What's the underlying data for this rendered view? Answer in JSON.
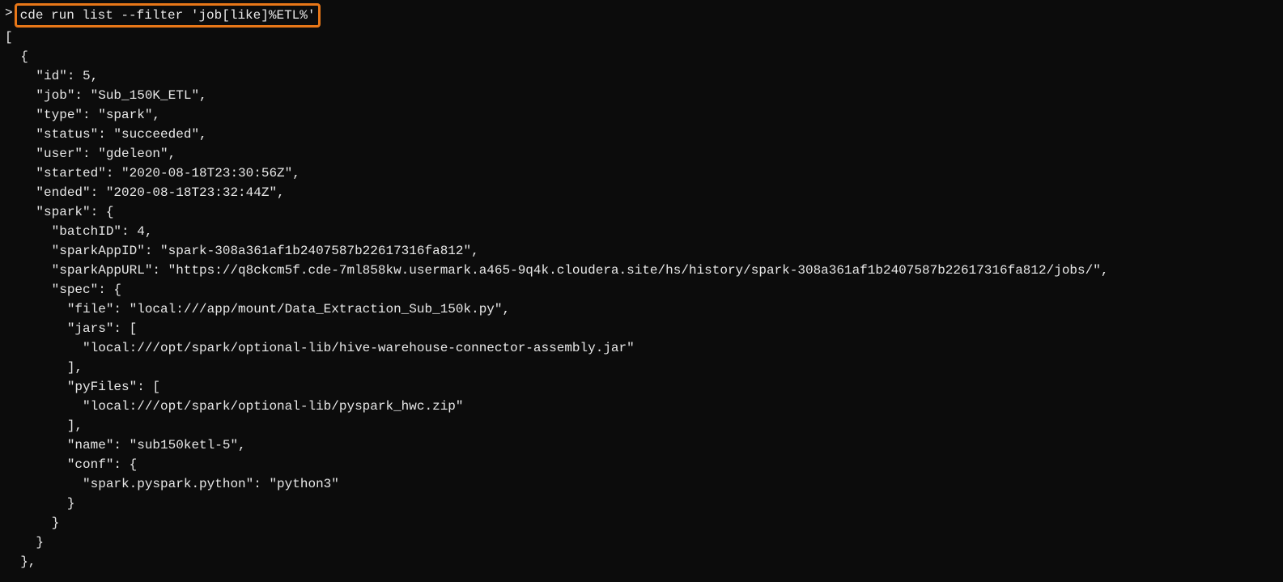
{
  "prompt": ">",
  "command": "cde run list --filter 'job[like]%ETL%'",
  "output_lines": [
    "[",
    "  {",
    "    \"id\": 5,",
    "    \"job\": \"Sub_150K_ETL\",",
    "    \"type\": \"spark\",",
    "    \"status\": \"succeeded\",",
    "    \"user\": \"gdeleon\",",
    "    \"started\": \"2020-08-18T23:30:56Z\",",
    "    \"ended\": \"2020-08-18T23:32:44Z\",",
    "    \"spark\": {",
    "      \"batchID\": 4,",
    "      \"sparkAppID\": \"spark-308a361af1b2407587b22617316fa812\",",
    "      \"sparkAppURL\": \"https://q8ckcm5f.cde-7ml858kw.usermark.a465-9q4k.cloudera.site/hs/history/spark-308a361af1b2407587b22617316fa812/jobs/\",",
    "      \"spec\": {",
    "        \"file\": \"local:///app/mount/Data_Extraction_Sub_150k.py\",",
    "        \"jars\": [",
    "          \"local:///opt/spark/optional-lib/hive-warehouse-connector-assembly.jar\"",
    "        ],",
    "        \"pyFiles\": [",
    "          \"local:///opt/spark/optional-lib/pyspark_hwc.zip\"",
    "        ],",
    "        \"name\": \"sub150ketl-5\",",
    "        \"conf\": {",
    "          \"spark.pyspark.python\": \"python3\"",
    "        }",
    "      }",
    "    }",
    "  },"
  ]
}
